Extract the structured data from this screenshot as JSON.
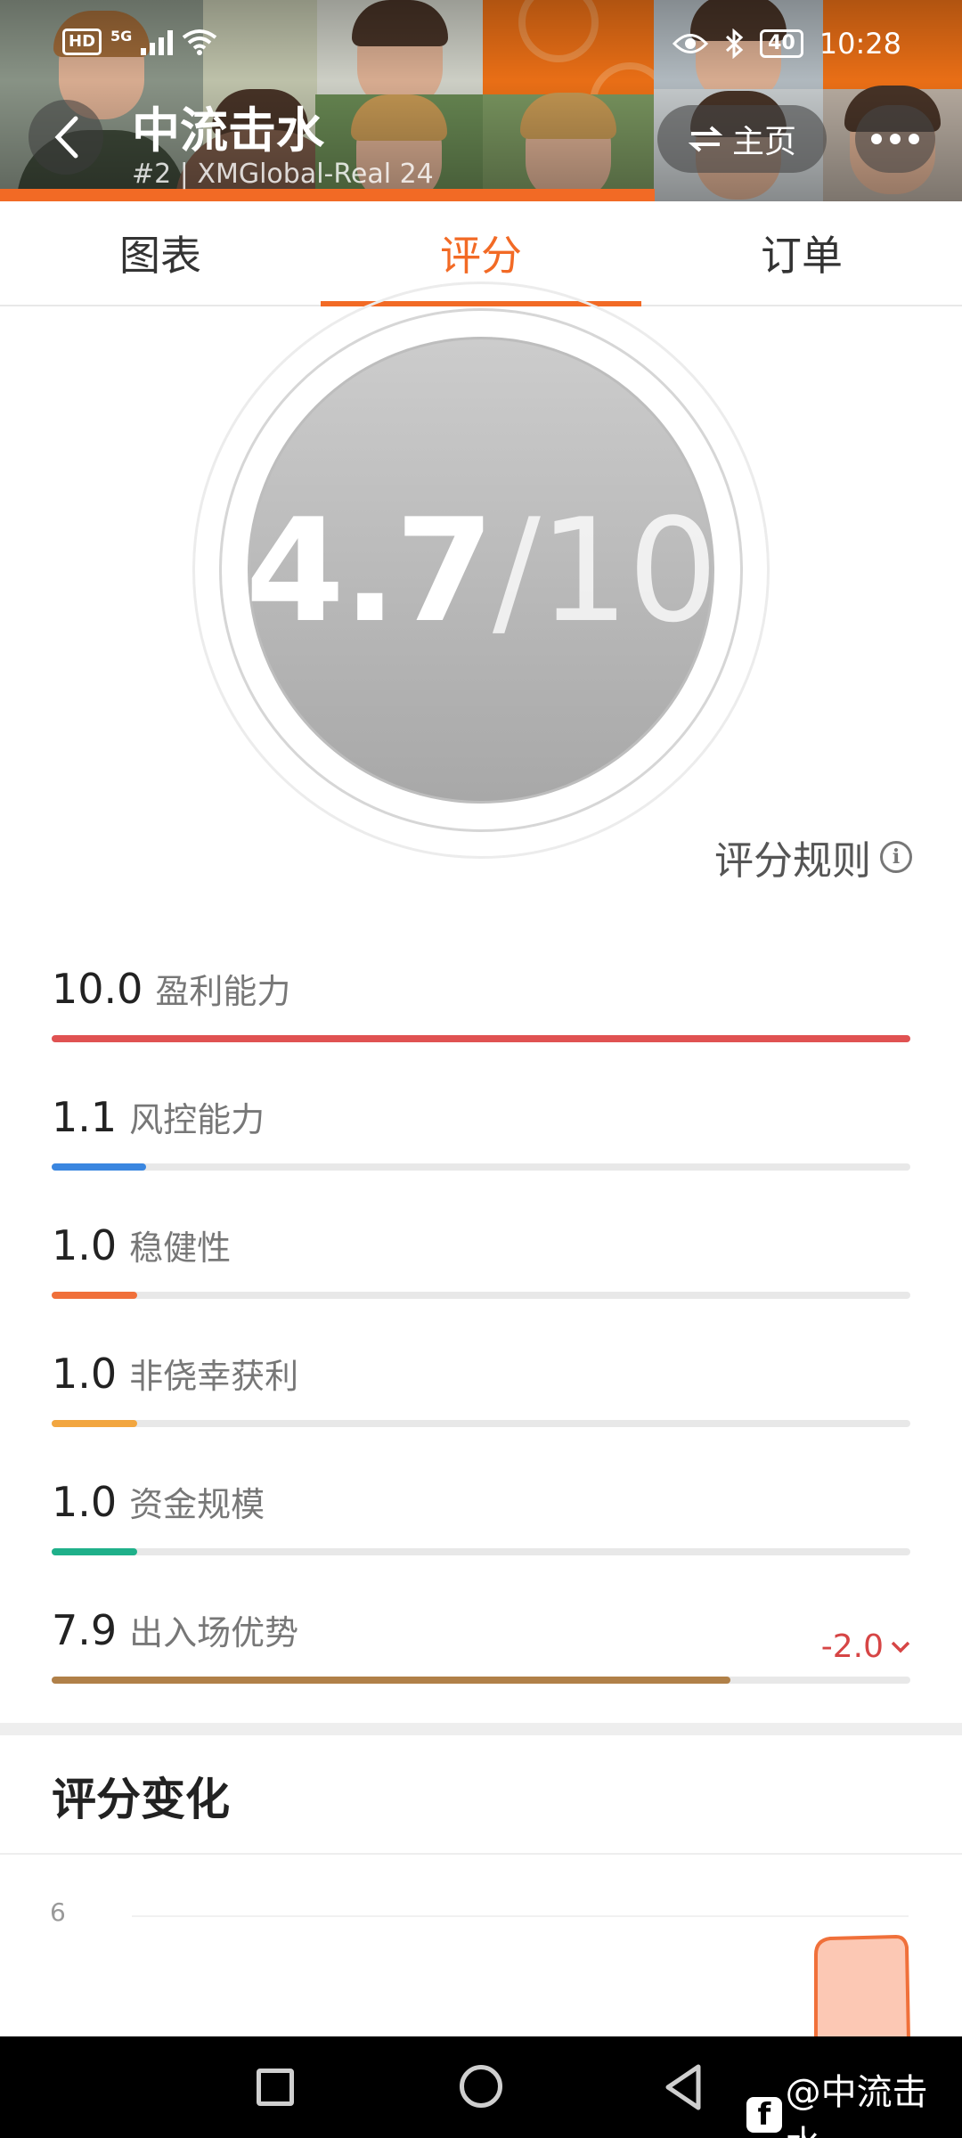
{
  "status_bar": {
    "hd": "HD",
    "network": "5G",
    "battery": "40",
    "time": "10:28"
  },
  "header": {
    "title": "中流击水",
    "subtitle": "#2 | XMGlobal-Real 24",
    "home_label": "主页"
  },
  "tabs": [
    {
      "label": "图表",
      "active": false
    },
    {
      "label": "评分",
      "active": true
    },
    {
      "label": "订单",
      "active": false
    }
  ],
  "score": {
    "value": "4.7",
    "denominator": "/10"
  },
  "rules_label": "评分规则",
  "metrics": [
    {
      "value": "10.0",
      "label": "盈利能力",
      "fraction": 1.0,
      "color": "#e05252"
    },
    {
      "value": "1.1",
      "label": "风控能力",
      "fraction": 0.11,
      "color": "#3a86e0"
    },
    {
      "value": "1.0",
      "label": "稳健性",
      "fraction": 0.1,
      "color": "#f0703a"
    },
    {
      "value": "1.0",
      "label": "非侥幸获利",
      "fraction": 0.1,
      "color": "#f2a640"
    },
    {
      "value": "1.0",
      "label": "资金规模",
      "fraction": 0.1,
      "color": "#1fb08a"
    },
    {
      "value": "7.9",
      "label": "出入场优势",
      "fraction": 0.79,
      "color": "#b08048",
      "delta": "-2.0"
    }
  ],
  "score_change": {
    "title": "评分变化",
    "y_tick": "6"
  },
  "watermark": "@中流击水",
  "colors": {
    "accent": "#f26a25",
    "delta_negative": "#d64545"
  }
}
